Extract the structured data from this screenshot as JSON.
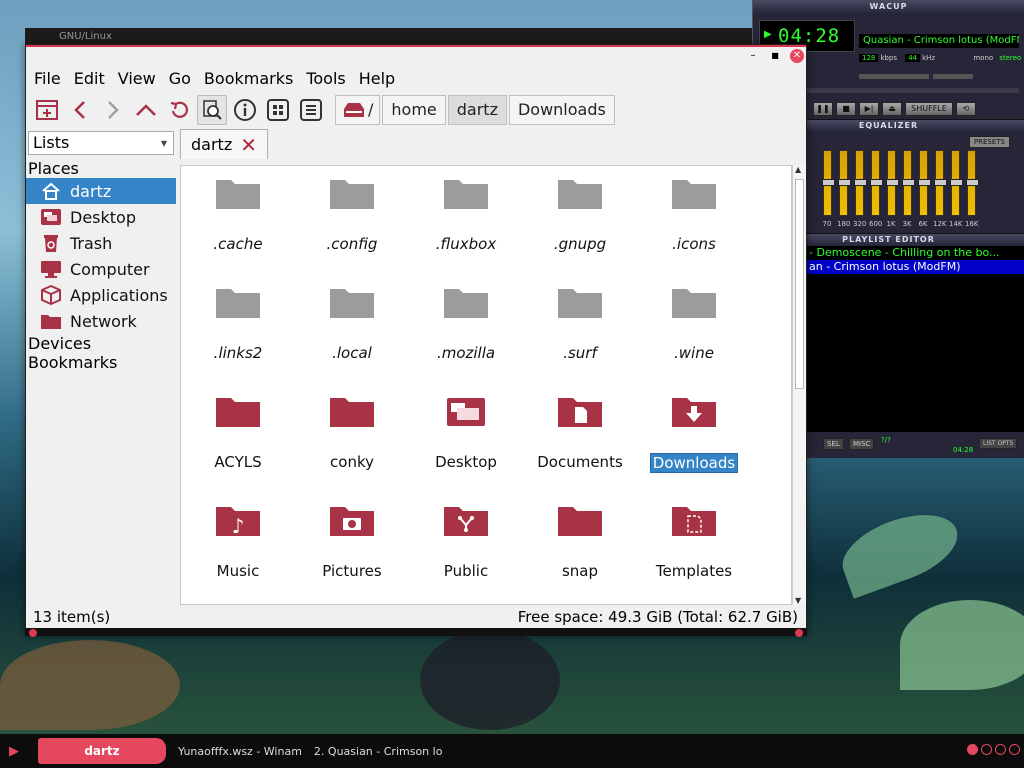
{
  "desktop": {
    "gnu_label": "GNU/Linux"
  },
  "winamp": {
    "title": "WACUP",
    "time": "04:28",
    "song": "Quasian - Crimson lotus (ModFM)",
    "kbps": "128",
    "kbps_label": "kbps",
    "khz": "44",
    "khz_label": "kHz",
    "mono": "mono",
    "stereo": "stereo",
    "shuffle": "SHUFFLE",
    "eq_title": "EQUALIZER",
    "presets": "PRESETS",
    "eq_bands": [
      "70",
      "180",
      "320",
      "600",
      "1K",
      "3K",
      "6K",
      "12K",
      "14K",
      "16K"
    ],
    "playlist_title": "PLAYLIST EDITOR",
    "playlist": [
      "- Demoscene - Chilling on the bo...",
      "an - Crimson lotus (ModFM)"
    ],
    "pl_sel": "SEL",
    "pl_misc": "MISC",
    "pl_list": "LIST OPTS",
    "pl_counter": "?/?",
    "pl_time": "04:28"
  },
  "menu": [
    "File",
    "Edit",
    "View",
    "Go",
    "Bookmarks",
    "Tools",
    "Help"
  ],
  "path": {
    "root": "/",
    "crumbs": [
      "home",
      "dartz",
      "Downloads"
    ]
  },
  "sidebar": {
    "select_value": "Lists",
    "places_heading": "Places",
    "items": [
      "dartz",
      "Desktop",
      "Trash",
      "Computer",
      "Applications",
      "Network"
    ],
    "devices_heading": "Devices",
    "bookmarks_heading": "Bookmarks"
  },
  "tab": {
    "label": "dartz"
  },
  "files": [
    {
      "name": ".cache"
    },
    {
      "name": ".config"
    },
    {
      "name": ".fluxbox"
    },
    {
      "name": ".gnupg"
    },
    {
      "name": ".icons"
    },
    {
      "name": ".links2"
    },
    {
      "name": ".local"
    },
    {
      "name": ".mozilla"
    },
    {
      "name": ".surf"
    },
    {
      "name": ".wine"
    },
    {
      "name": "ACYLS"
    },
    {
      "name": "conky"
    },
    {
      "name": "Desktop"
    },
    {
      "name": "Documents"
    },
    {
      "name": "Downloads"
    },
    {
      "name": "Music"
    },
    {
      "name": "Pictures"
    },
    {
      "name": "Public"
    },
    {
      "name": "snap"
    },
    {
      "name": "Templates"
    }
  ],
  "status": {
    "count": "13 item(s)",
    "free": "Free space: 49.3 GiB (Total: 62.7 GiB)"
  },
  "taskbar": {
    "workspace": "dartz",
    "tasks": [
      "Yunaofffx.wsz - Winam",
      "2. Quasian - Crimson lo"
    ]
  },
  "colors": {
    "accent": "#e5475f",
    "folder_grey": "#9c9c9c",
    "folder_red": "#a83347",
    "selection": "#3584c8"
  }
}
